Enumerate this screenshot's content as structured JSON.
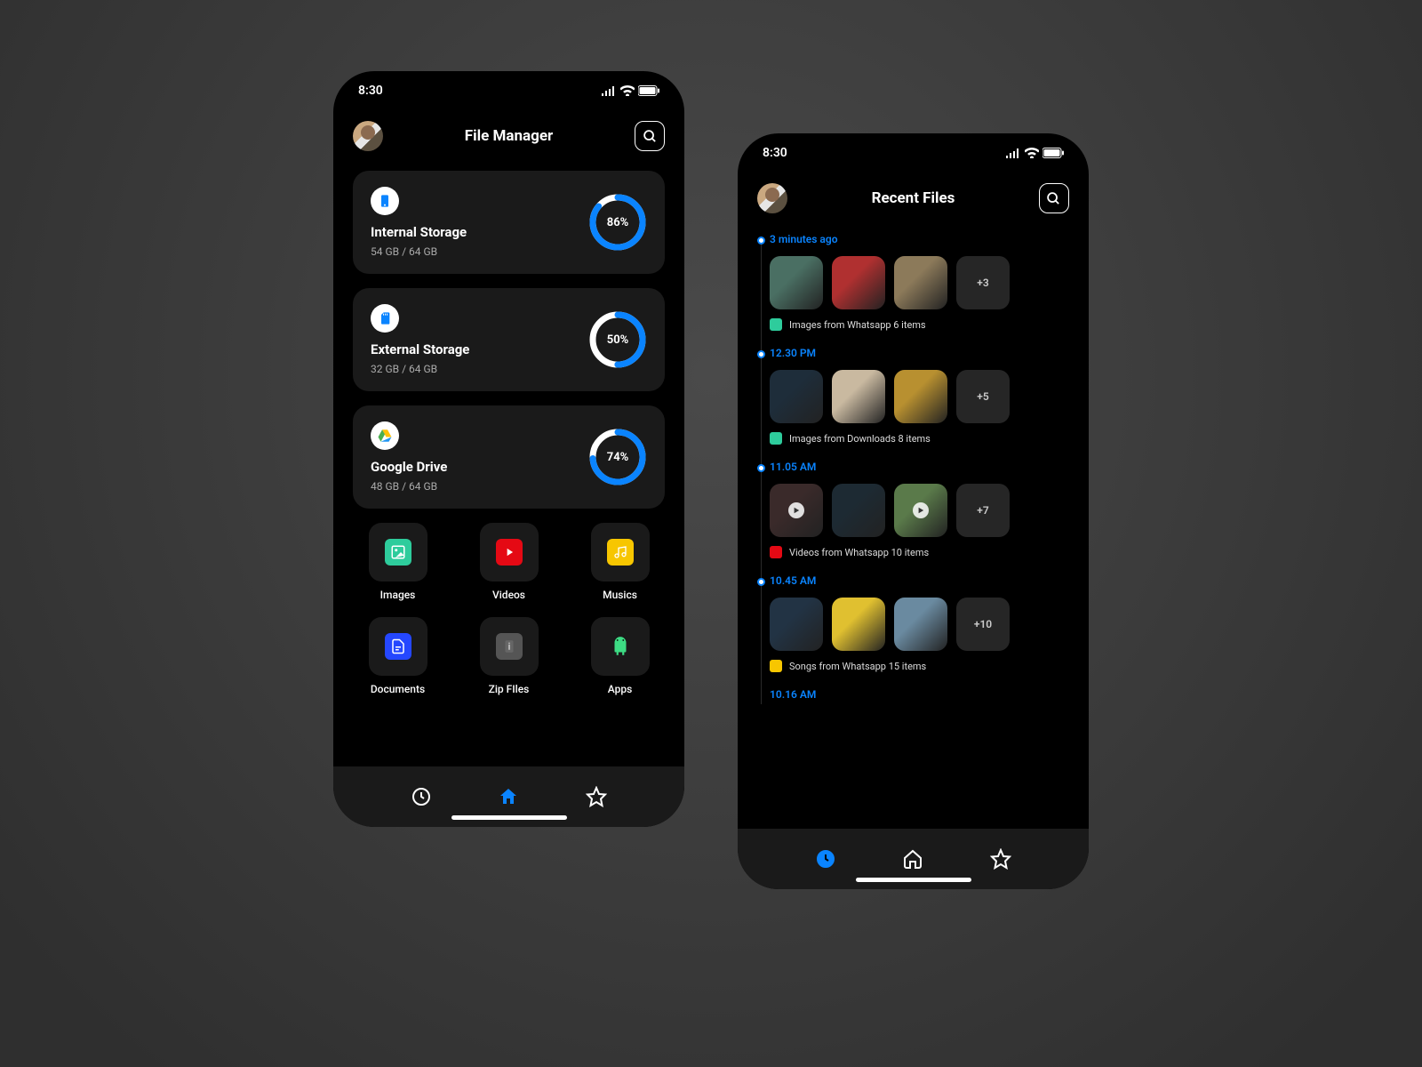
{
  "status_time": "8:30",
  "left": {
    "title": "File Manager",
    "storages": [
      {
        "name": "Internal Storage",
        "usage": "54 GB / 64 GB",
        "percent": 86,
        "icon": "phone-icon"
      },
      {
        "name": "External Storage",
        "usage": "32 GB / 64 GB",
        "percent": 50,
        "icon": "sd-card-icon"
      },
      {
        "name": "Google Drive",
        "usage": "48 GB / 64 GB",
        "percent": 74,
        "icon": "google-drive-icon"
      }
    ],
    "categories": [
      {
        "label": "Images",
        "color": "#2ecc9c",
        "icon": "image-icon"
      },
      {
        "label": "Videos",
        "color": "#e50914",
        "icon": "youtube-icon"
      },
      {
        "label": "Musics",
        "color": "#f7c600",
        "icon": "music-icon"
      },
      {
        "label": "Documents",
        "color": "#2547ff",
        "icon": "document-icon"
      },
      {
        "label": "Zip FIles",
        "color": "#555555",
        "icon": "zip-icon"
      },
      {
        "label": "Apps",
        "color": "transparent",
        "icon": "android-icon"
      }
    ],
    "nav_active_index": 1
  },
  "right": {
    "title": "Recent Files",
    "timeline": [
      {
        "time": "3 minutes ago",
        "more": "+3",
        "badge_color": "#2ecc9c",
        "caption": "Images from Whatsapp 6 items",
        "type": "image"
      },
      {
        "time": "12.30 PM",
        "more": "+5",
        "badge_color": "#2ecc9c",
        "caption": "Images from Downloads 8 items",
        "type": "image"
      },
      {
        "time": "11.05 AM",
        "more": "+7",
        "badge_color": "#e50914",
        "caption": "Videos from Whatsapp 10 items",
        "type": "video"
      },
      {
        "time": "10.45 AM",
        "more": "+10",
        "badge_color": "#f7c600",
        "caption": "Songs from Whatsapp 15 items",
        "type": "music"
      },
      {
        "time": "10.16 AM",
        "more": "",
        "badge_color": "#2ecc9c",
        "caption": "",
        "type": "image"
      }
    ],
    "nav_active_index": 0
  },
  "thumb_palettes": [
    [
      "#4a6f63",
      "#b03030",
      "#8c7a5a",
      "#262626"
    ],
    [
      "#1e2d3a",
      "#c9b9a0",
      "#b89030",
      "#2a2a2a"
    ],
    [
      "#3a2a2a",
      "#1d2a33",
      "#5a7a4a",
      "#7aa0b0"
    ],
    [
      "#223344",
      "#e0c030",
      "#6a8aa0",
      "#262626"
    ]
  ],
  "colors": {
    "accent": "#0a84ff",
    "ring_bg": "#ffffff"
  }
}
